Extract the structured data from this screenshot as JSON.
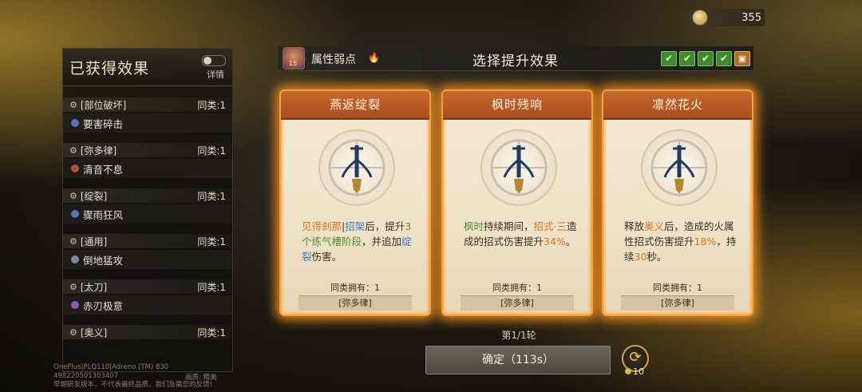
{
  "currency": {
    "icon": "coin-icon",
    "value": "355"
  },
  "left_panel": {
    "title": "已获得效果",
    "toggle_label": "详情",
    "groups": [
      {
        "category": "[部位破坏]",
        "count": "同类:1",
        "item": "要害碎击",
        "item_color": "#5a6fc0"
      },
      {
        "category": "[弥多律]",
        "count": "同类:1",
        "item": "清音不息",
        "item_color": "#b0503a"
      },
      {
        "category": "[绽裂]",
        "count": "同类:1",
        "item": "骤雨狂风",
        "item_color": "#5a6fc0"
      },
      {
        "category": "[通用]",
        "count": "同类:1",
        "item": "倒地猛攻",
        "item_color": "#7a8a9a"
      },
      {
        "category": "[太刀]",
        "count": "同类:1",
        "item": "赤刃极意",
        "item_color": "#8a5ab0"
      },
      {
        "category": "[奥义]",
        "count": "同类:1"
      }
    ]
  },
  "header": {
    "boss_level": "15",
    "weakness_label": "属性弱点",
    "title": "选择提升效果",
    "checks": [
      "✔",
      "✔",
      "✔",
      "✔"
    ]
  },
  "cards": [
    {
      "title": "燕返绽裂",
      "owned": "同类拥有：1",
      "tag": "[弥多律]"
    },
    {
      "title": "枫时残响",
      "owned": "同类拥有：1",
      "tag": "[弥多律]"
    },
    {
      "title": "凛然花火",
      "owned": "同类拥有：1",
      "tag": "[弥多律]"
    }
  ],
  "card_texts": {
    "c1": {
      "p1": "见得刹那",
      "p2": "|",
      "p3": "招架",
      "p4": "后，提升",
      "p5": "3个",
      "p6": "练气槽阶段",
      "p7": "，并追加",
      "p8": "绽裂",
      "p9": "伤害。"
    },
    "c2": {
      "p1": "枫时",
      "p2": "持续期间，",
      "p3": "招式·三",
      "p4": "造成的招式伤害提升",
      "p5": "34%",
      "p6": "。"
    },
    "c3": {
      "p1": "释放",
      "p2": "奥义",
      "p3": "后，造成的火属性招式伤害提升",
      "p4": "18%",
      "p5": "，持续",
      "p6": "30",
      "p7": "秒。"
    }
  },
  "footer": {
    "round": "第1/1轮",
    "confirm": "确定（113s）",
    "refresh_cost": "10"
  },
  "watermark": {
    "line1": "OnePlus|PLQ110|Adreno (TM) 830",
    "line2": "498220501303407",
    "line3": "画质: 精美",
    "line4": "早期研发版本，不代表最终品质，我们急需您的反馈!"
  }
}
